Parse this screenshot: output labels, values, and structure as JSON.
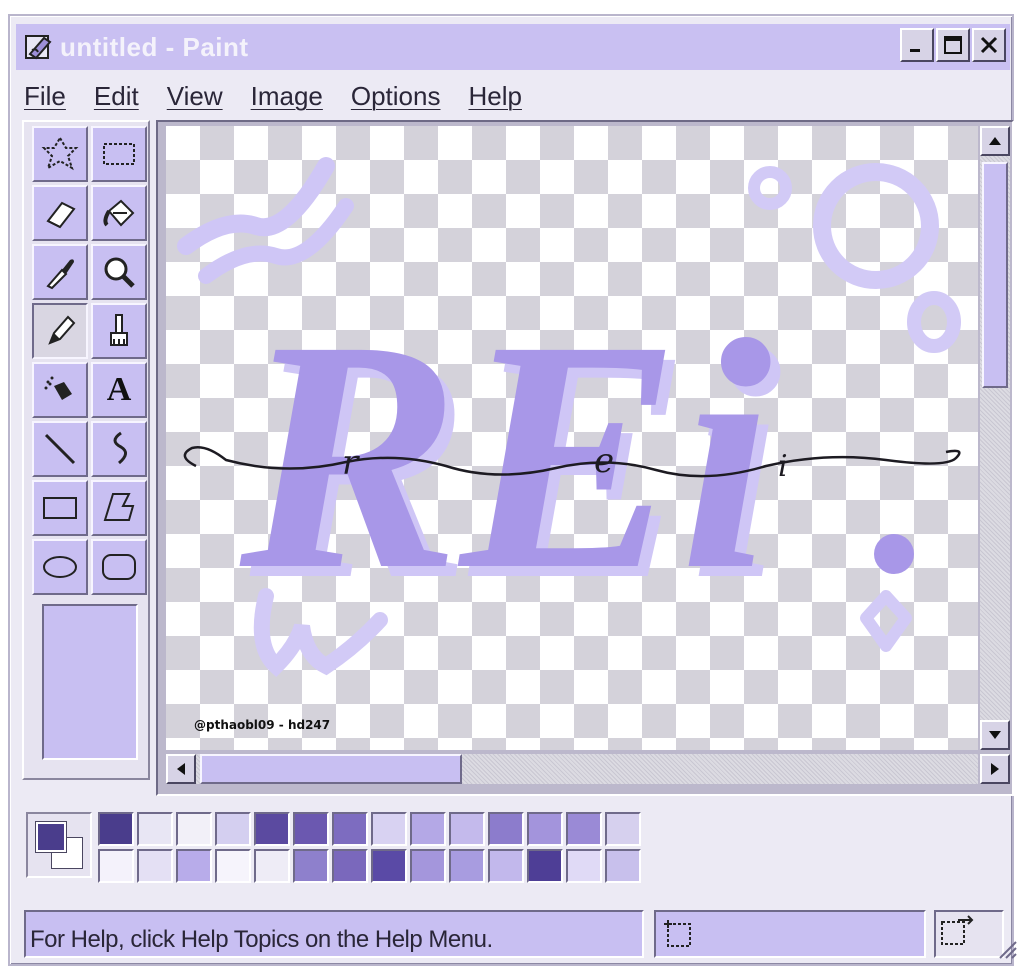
{
  "window": {
    "title": "untitled - Paint",
    "controls": [
      "minimize",
      "maximize",
      "close"
    ]
  },
  "menu": [
    "File",
    "Edit",
    "View",
    "Image",
    "Options",
    "Help"
  ],
  "toolbox": {
    "tools": [
      {
        "name": "free-form-select-icon"
      },
      {
        "name": "rect-select-icon"
      },
      {
        "name": "eraser-icon"
      },
      {
        "name": "fill-bucket-icon"
      },
      {
        "name": "color-picker-icon"
      },
      {
        "name": "magnifier-icon"
      },
      {
        "name": "pencil-icon",
        "active": true
      },
      {
        "name": "brush-icon"
      },
      {
        "name": "airbrush-icon"
      },
      {
        "name": "text-icon",
        "glyph": "A"
      },
      {
        "name": "line-icon"
      },
      {
        "name": "curve-icon"
      },
      {
        "name": "rectangle-icon"
      },
      {
        "name": "polygon-icon"
      },
      {
        "name": "ellipse-icon"
      },
      {
        "name": "rounded-rect-icon"
      }
    ]
  },
  "canvas": {
    "artwork_text": "REi",
    "script_letters": [
      "r",
      "e",
      "i"
    ],
    "credit": "@pthaobl09 - hd247"
  },
  "palette": {
    "foreground": "#4a3d8c",
    "background": "#ffffff",
    "colors": [
      "#4a3d8c",
      "#e8e6f4",
      "#f2f0f8",
      "#d4cff0",
      "#5b4aa0",
      "#6b58b0",
      "#7d6cc0",
      "#d8d2f2",
      "#b4a8e6",
      "#c4baec",
      "#8c7ccc",
      "#a394dc",
      "#9a8ad6",
      "#d6d0ee",
      "#f4f2fb",
      "#e4e0f4",
      "#b8acea",
      "#f6f4fc",
      "#eeecf6",
      "#8e80cc",
      "#7a68bc",
      "#5a4aa6",
      "#a496dc",
      "#a89ce0",
      "#c2b8ec",
      "#4e3e96",
      "#e0daf6",
      "#c8c0ec"
    ]
  },
  "status": {
    "help_text": "For Help, click Help Topics on the Help Menu."
  },
  "colors": {
    "accent": "#c8bff2",
    "art_main": "#a897e8",
    "art_light": "#cfc6f6",
    "art_dark": "#8f7de0"
  }
}
